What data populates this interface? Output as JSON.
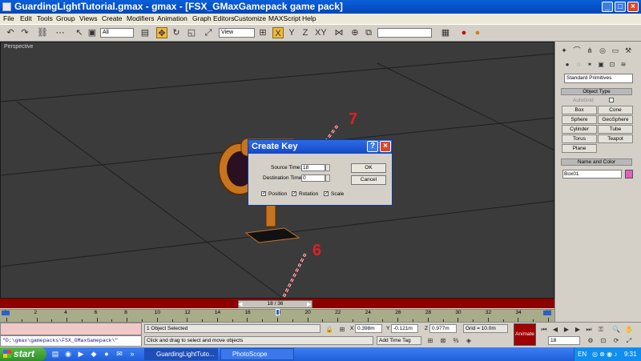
{
  "window": {
    "title": "GuardingLightTutorial.gmax - gmax - [FSX_GMaxGamepack game pack]",
    "controls": [
      "_",
      "□",
      "×"
    ]
  },
  "menu": [
    "File",
    "Edit",
    "Tools",
    "Group",
    "Views",
    "Create",
    "Modifiers",
    "Animation",
    "Graph Editors",
    "Customize",
    "MAXScript",
    "Help"
  ],
  "toolbar": {
    "selection_filter": "All",
    "reference_coord": "View"
  },
  "viewport": {
    "label": "Perspective"
  },
  "annotations": {
    "arrow_7": "7",
    "arrow_6": "6",
    "color": "#e02020"
  },
  "dialog": {
    "title": "Create Key",
    "source_time_label": "Source Time:",
    "source_time_value": "18",
    "destination_time_label": "Destination Time:",
    "destination_time_value": "0",
    "ok_label": "OK",
    "cancel_label": "Cancel",
    "position_label": "Position",
    "rotation_label": "Rotation",
    "scale_label": "Scale",
    "help_icon": "question-icon",
    "close_icon": "close-icon"
  },
  "command_panel": {
    "category_select": "Standard Primitives",
    "object_type_header": "Object Type",
    "autogrid_label": "AutoGrid",
    "primitives": [
      "Box",
      "Cone",
      "Sphere",
      "GeoSphere",
      "Cylinder",
      "Tube",
      "Torus",
      "Teapot",
      "Plane"
    ],
    "name_color_header": "Name and Color",
    "object_name": "Box01",
    "object_color": "#e060c0"
  },
  "timeline": {
    "time_slider": "18 / 36",
    "current_frame": 18,
    "total_frames": 36,
    "tick_labels": [
      "0",
      "2",
      "4",
      "6",
      "8",
      "10",
      "12",
      "14",
      "16",
      "18",
      "20",
      "22",
      "24",
      "26",
      "28",
      "30",
      "32",
      "34",
      "36"
    ]
  },
  "status": {
    "maxscript_listener": "\"D:\\gmax\\gamepacks\\FSX_GMaxGamepack\\\"",
    "selection_status": "1 Object Selected",
    "prompt": "Click and drag to select and move objects",
    "x_label": "X",
    "x_value": "0.398m",
    "y_label": "Y",
    "y_value": "-0.121m",
    "z_label": "Z",
    "z_value": "0.977m",
    "grid": "Grid = 10.0m",
    "add_time_tag": "Add Time Tag",
    "animate_label": "Animate",
    "frame_field": "18"
  },
  "taskbar": {
    "start_label": "start",
    "tasks": [
      "GuardingLightTuto...",
      "PhotoScope"
    ],
    "language": "EN",
    "clock": "9:31"
  }
}
